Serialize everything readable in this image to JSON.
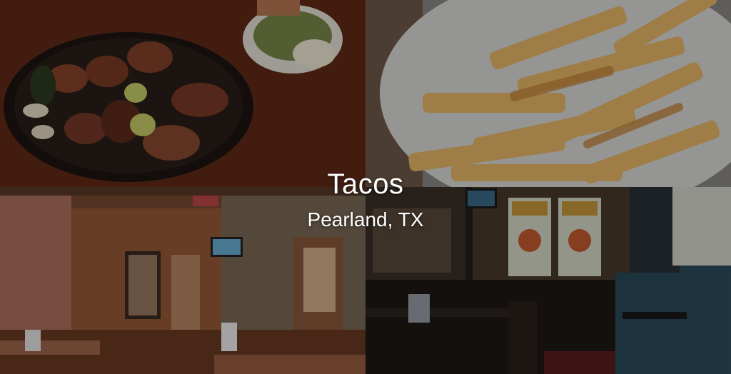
{
  "hero": {
    "title": "Tacos",
    "subtitle": "Pearland, TX"
  },
  "photos": [
    {
      "subject": "bacon-wrapped shrimp skillet"
    },
    {
      "subject": "basket of seasoned fries"
    },
    {
      "subject": "rustic dining room interior"
    },
    {
      "subject": "bar and dining area interior"
    }
  ],
  "colors": {
    "overlay": "#000000",
    "text": "#ffffff"
  }
}
